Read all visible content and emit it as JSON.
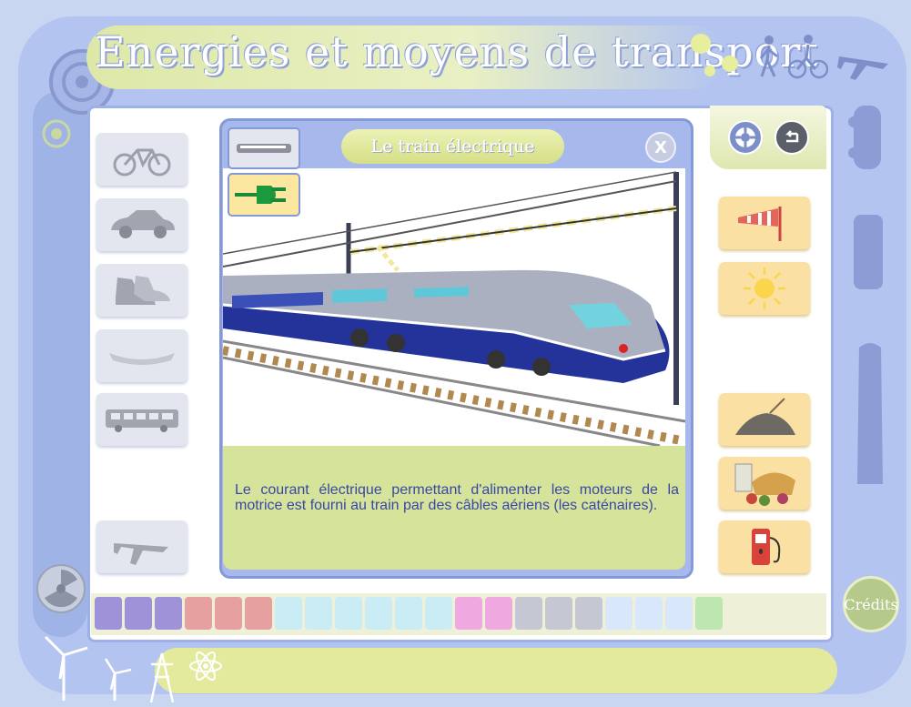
{
  "app": {
    "title": "Energies et moyens de transport"
  },
  "popup": {
    "title": "Le train électrique",
    "close_label": "X",
    "description": "Le courant électrique permettant d'alimenter les moteurs de la motrice est fourni au train par des câbles aériens (les caténaires)."
  },
  "credits_label": "Crédits",
  "left_menu": [
    {
      "icon": "bicycle-icon"
    },
    {
      "icon": "car-icon"
    },
    {
      "icon": "shoes-icon"
    },
    {
      "icon": "boat-icon"
    },
    {
      "icon": "bus-icon"
    },
    {
      "icon": "airplane-icon"
    }
  ],
  "right_menu": [
    {
      "icon": "windsock-icon"
    },
    {
      "icon": "sun-icon"
    },
    {
      "icon": "coal-icon"
    },
    {
      "icon": "food-icon"
    },
    {
      "icon": "fuel-pump-icon"
    }
  ],
  "colors": {
    "frame": "#b3c4f0",
    "accent_green": "#d6e39a",
    "text_blue": "#3847a8",
    "energy_button": "#fbe0a3"
  }
}
